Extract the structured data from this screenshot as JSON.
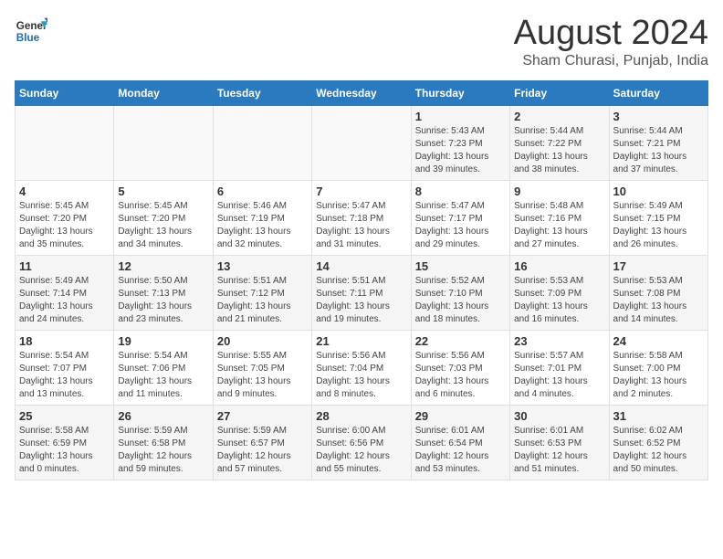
{
  "header": {
    "logo_line1": "General",
    "logo_line2": "Blue",
    "title": "August 2024",
    "subtitle": "Sham Churasi, Punjab, India"
  },
  "days_of_week": [
    "Sunday",
    "Monday",
    "Tuesday",
    "Wednesday",
    "Thursday",
    "Friday",
    "Saturday"
  ],
  "weeks": [
    [
      {
        "day": "",
        "info": ""
      },
      {
        "day": "",
        "info": ""
      },
      {
        "day": "",
        "info": ""
      },
      {
        "day": "",
        "info": ""
      },
      {
        "day": "1",
        "info": "Sunrise: 5:43 AM\nSunset: 7:23 PM\nDaylight: 13 hours\nand 39 minutes."
      },
      {
        "day": "2",
        "info": "Sunrise: 5:44 AM\nSunset: 7:22 PM\nDaylight: 13 hours\nand 38 minutes."
      },
      {
        "day": "3",
        "info": "Sunrise: 5:44 AM\nSunset: 7:21 PM\nDaylight: 13 hours\nand 37 minutes."
      }
    ],
    [
      {
        "day": "4",
        "info": "Sunrise: 5:45 AM\nSunset: 7:20 PM\nDaylight: 13 hours\nand 35 minutes."
      },
      {
        "day": "5",
        "info": "Sunrise: 5:45 AM\nSunset: 7:20 PM\nDaylight: 13 hours\nand 34 minutes."
      },
      {
        "day": "6",
        "info": "Sunrise: 5:46 AM\nSunset: 7:19 PM\nDaylight: 13 hours\nand 32 minutes."
      },
      {
        "day": "7",
        "info": "Sunrise: 5:47 AM\nSunset: 7:18 PM\nDaylight: 13 hours\nand 31 minutes."
      },
      {
        "day": "8",
        "info": "Sunrise: 5:47 AM\nSunset: 7:17 PM\nDaylight: 13 hours\nand 29 minutes."
      },
      {
        "day": "9",
        "info": "Sunrise: 5:48 AM\nSunset: 7:16 PM\nDaylight: 13 hours\nand 27 minutes."
      },
      {
        "day": "10",
        "info": "Sunrise: 5:49 AM\nSunset: 7:15 PM\nDaylight: 13 hours\nand 26 minutes."
      }
    ],
    [
      {
        "day": "11",
        "info": "Sunrise: 5:49 AM\nSunset: 7:14 PM\nDaylight: 13 hours\nand 24 minutes."
      },
      {
        "day": "12",
        "info": "Sunrise: 5:50 AM\nSunset: 7:13 PM\nDaylight: 13 hours\nand 23 minutes."
      },
      {
        "day": "13",
        "info": "Sunrise: 5:51 AM\nSunset: 7:12 PM\nDaylight: 13 hours\nand 21 minutes."
      },
      {
        "day": "14",
        "info": "Sunrise: 5:51 AM\nSunset: 7:11 PM\nDaylight: 13 hours\nand 19 minutes."
      },
      {
        "day": "15",
        "info": "Sunrise: 5:52 AM\nSunset: 7:10 PM\nDaylight: 13 hours\nand 18 minutes."
      },
      {
        "day": "16",
        "info": "Sunrise: 5:53 AM\nSunset: 7:09 PM\nDaylight: 13 hours\nand 16 minutes."
      },
      {
        "day": "17",
        "info": "Sunrise: 5:53 AM\nSunset: 7:08 PM\nDaylight: 13 hours\nand 14 minutes."
      }
    ],
    [
      {
        "day": "18",
        "info": "Sunrise: 5:54 AM\nSunset: 7:07 PM\nDaylight: 13 hours\nand 13 minutes."
      },
      {
        "day": "19",
        "info": "Sunrise: 5:54 AM\nSunset: 7:06 PM\nDaylight: 13 hours\nand 11 minutes."
      },
      {
        "day": "20",
        "info": "Sunrise: 5:55 AM\nSunset: 7:05 PM\nDaylight: 13 hours\nand 9 minutes."
      },
      {
        "day": "21",
        "info": "Sunrise: 5:56 AM\nSunset: 7:04 PM\nDaylight: 13 hours\nand 8 minutes."
      },
      {
        "day": "22",
        "info": "Sunrise: 5:56 AM\nSunset: 7:03 PM\nDaylight: 13 hours\nand 6 minutes."
      },
      {
        "day": "23",
        "info": "Sunrise: 5:57 AM\nSunset: 7:01 PM\nDaylight: 13 hours\nand 4 minutes."
      },
      {
        "day": "24",
        "info": "Sunrise: 5:58 AM\nSunset: 7:00 PM\nDaylight: 13 hours\nand 2 minutes."
      }
    ],
    [
      {
        "day": "25",
        "info": "Sunrise: 5:58 AM\nSunset: 6:59 PM\nDaylight: 13 hours\nand 0 minutes."
      },
      {
        "day": "26",
        "info": "Sunrise: 5:59 AM\nSunset: 6:58 PM\nDaylight: 12 hours\nand 59 minutes."
      },
      {
        "day": "27",
        "info": "Sunrise: 5:59 AM\nSunset: 6:57 PM\nDaylight: 12 hours\nand 57 minutes."
      },
      {
        "day": "28",
        "info": "Sunrise: 6:00 AM\nSunset: 6:56 PM\nDaylight: 12 hours\nand 55 minutes."
      },
      {
        "day": "29",
        "info": "Sunrise: 6:01 AM\nSunset: 6:54 PM\nDaylight: 12 hours\nand 53 minutes."
      },
      {
        "day": "30",
        "info": "Sunrise: 6:01 AM\nSunset: 6:53 PM\nDaylight: 12 hours\nand 51 minutes."
      },
      {
        "day": "31",
        "info": "Sunrise: 6:02 AM\nSunset: 6:52 PM\nDaylight: 12 hours\nand 50 minutes."
      }
    ]
  ]
}
